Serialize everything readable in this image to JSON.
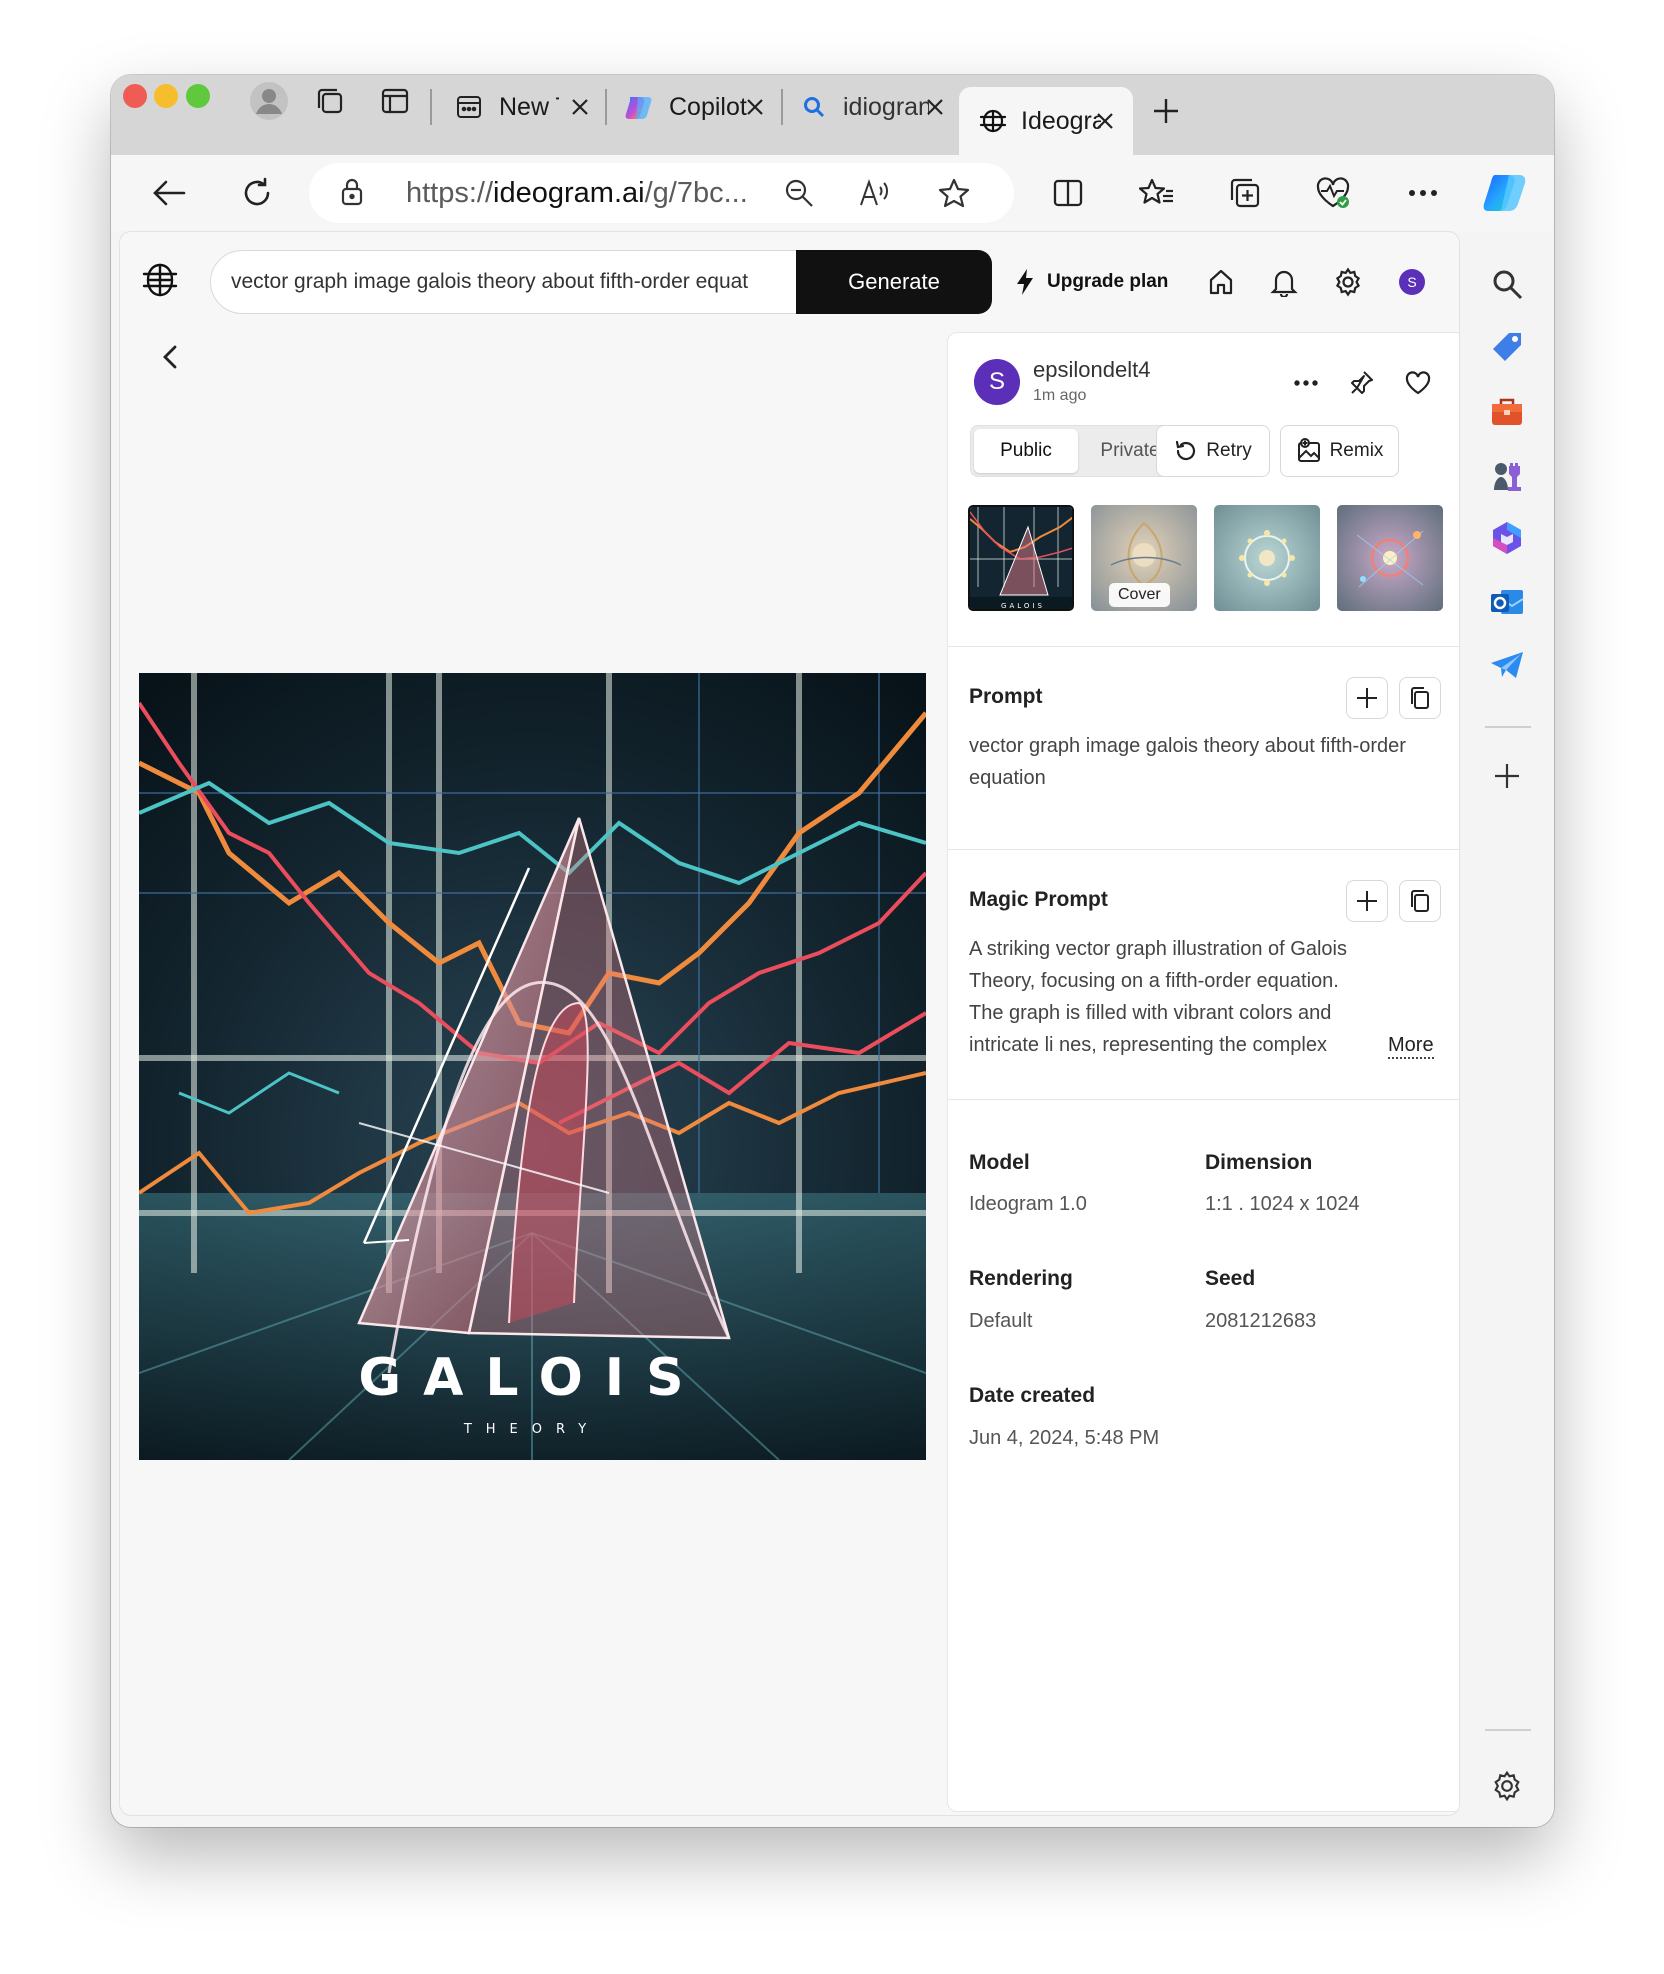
{
  "tabs": [
    {
      "label": "New Ta"
    },
    {
      "label": "Copilot"
    },
    {
      "label": "idiogran"
    },
    {
      "label": "Ideogra"
    }
  ],
  "address": {
    "prefix": "https://",
    "domain": "ideogram.ai",
    "path": "/g/7bc..."
  },
  "header": {
    "prompt_value": "vector graph image galois theory about fifth-order equat",
    "generate_label": "Generate",
    "upgrade_label": "Upgrade plan",
    "avatar_initial": "S"
  },
  "image": {
    "title": "GALOIS",
    "subtitle": "THEORY"
  },
  "panel": {
    "avatar_initial": "S",
    "username": "epsilondelt4",
    "time": "1m ago",
    "visibility_public": "Public",
    "visibility_private": "Private",
    "retry_label": "Retry",
    "remix_label": "Remix",
    "cover_label": "Cover",
    "prompt_title": "Prompt",
    "prompt_text": "vector graph image galois theory about fifth-order equation",
    "magic_title": "Magic Prompt",
    "magic_text": "A striking vector graph illustration of Galois Theory, focusing on a fifth-order equation. The graph is filled with vibrant colors and intricate li nes, representing the complex algebraic...",
    "more_label": "More",
    "model_label": "Model",
    "model_value": "Ideogram 1.0",
    "dimension_label": "Dimension",
    "dimension_value": "1:1 . 1024 x 1024",
    "rendering_label": "Rendering",
    "rendering_value": "Default",
    "seed_label": "Seed",
    "seed_value": "2081212683",
    "date_label": "Date created",
    "date_value": "Jun 4, 2024, 5:48 PM"
  },
  "colors": {
    "accent": "#5b2fb8",
    "generate_bg": "#111111"
  }
}
